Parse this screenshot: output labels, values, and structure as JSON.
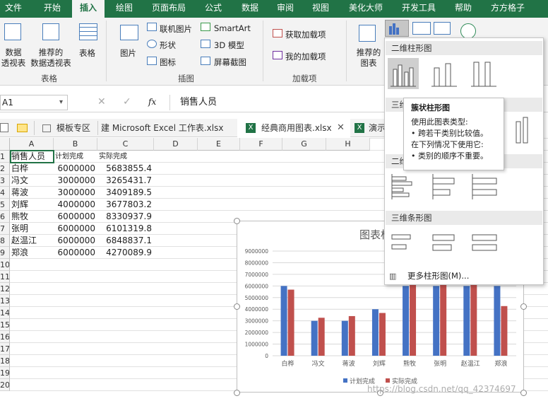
{
  "ribbon_tabs": [
    "文件",
    "开始",
    "插入",
    "绘图",
    "页面布局",
    "公式",
    "数据",
    "审阅",
    "视图",
    "美化大师",
    "开发工具",
    "帮助",
    "方方格子"
  ],
  "ribbon": {
    "pivot": "数据\n透视表",
    "rec_pivot": "推荐的\n数据透视表",
    "table": "表格",
    "group_tables": "表格",
    "picture": "图片",
    "online_picture": "联机图片",
    "shapes": "形状",
    "icons": "图标",
    "smartart": "SmartArt",
    "model3d": "3D 模型",
    "screenshot": "屏幕截图",
    "group_illus": "插图",
    "get_addins": "获取加载项",
    "my_addins": "我的加载项",
    "group_addins": "加载项",
    "rec_charts": "推荐的\n图表"
  },
  "formula_bar": {
    "name_box": "A1",
    "fx": "fx",
    "content": "销售人员"
  },
  "doc_tabs": [
    "模板专区",
    "建 Microsoft Excel 工作表.xlsx",
    "经典商用图表.xlsx",
    "演示"
  ],
  "columns": [
    "A",
    "B",
    "C",
    "D",
    "E",
    "F",
    "G",
    "H"
  ],
  "rows": [
    "1",
    "2",
    "3",
    "4",
    "5",
    "6",
    "7",
    "8",
    "9",
    "10",
    "11",
    "12",
    "13",
    "14",
    "15",
    "16",
    "17",
    "18",
    "19",
    "20"
  ],
  "table": {
    "headers": [
      "销售人员",
      "计划完成",
      "实际完成"
    ],
    "rows": [
      [
        "白桦",
        "6000000",
        "5683855.4"
      ],
      [
        "冯文",
        "3000000",
        "3265431.7"
      ],
      [
        "蒋波",
        "3000000",
        "3409189.5"
      ],
      [
        "刘辉",
        "4000000",
        "3677803.2"
      ],
      [
        "熊牧",
        "6000000",
        "8330937.9"
      ],
      [
        "张明",
        "6000000",
        "6101319.8"
      ],
      [
        "赵温江",
        "6000000",
        "6848837.1"
      ],
      [
        "郑浪",
        "6000000",
        "4270089.9"
      ]
    ]
  },
  "chart_data": {
    "type": "bar",
    "title": "图表标题",
    "categories": [
      "白桦",
      "冯文",
      "蒋波",
      "刘辉",
      "熊牧",
      "张明",
      "赵温江",
      "郑浪"
    ],
    "series": [
      {
        "name": "计划完成",
        "values": [
          6000000,
          3000000,
          3000000,
          4000000,
          6000000,
          6000000,
          6000000,
          6000000
        ],
        "color": "#4472c4"
      },
      {
        "name": "实际完成",
        "values": [
          5683855.4,
          3265431.7,
          3409189.5,
          3677803.2,
          8330937.9,
          6101319.8,
          6848837.1,
          4270089.9
        ],
        "color": "#c0504d"
      }
    ],
    "yticks": [
      "0",
      "1000000",
      "2000000",
      "3000000",
      "4000000",
      "5000000",
      "6000000",
      "7000000",
      "8000000",
      "9000000"
    ],
    "ylim": [
      0,
      9000000
    ],
    "legend": "bottom"
  },
  "dropdown": {
    "sec1": "二维柱形图",
    "sec2": "三维柱形图",
    "sec3": "二维条形图",
    "sec4": "三维条形图",
    "more": "更多柱形图(M)..."
  },
  "tooltip": {
    "title": "簇状柱形图",
    "line1": "使用此图表类型:",
    "line2": "• 跨若干类别比较值。",
    "line3": "在下列情况下使用它:",
    "line4": "• 类别的顺序不重要。"
  },
  "watermark": "https://blog.csdn.net/qq_42374697"
}
